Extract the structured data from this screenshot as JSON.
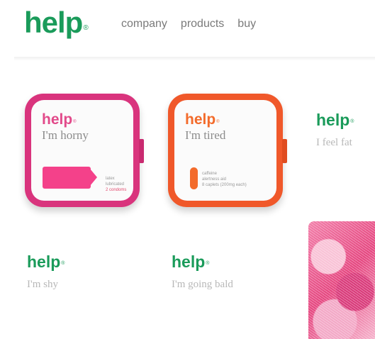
{
  "brand": {
    "logo": "help",
    "reg": "®"
  },
  "nav": [
    {
      "label": "company"
    },
    {
      "label": "products"
    },
    {
      "label": "buy"
    }
  ],
  "products": [
    {
      "brand": "help",
      "phrase": "I'm horny",
      "color": "#d9347d",
      "small_lines": [
        "latex",
        "lubricated",
        "2 condoms"
      ]
    },
    {
      "brand": "help",
      "phrase": "I'm tired",
      "color": "#f0582a",
      "small_lines": [
        "caffeine",
        "alertness aid",
        "8 caplets (200mg each)"
      ]
    }
  ],
  "tiles": [
    {
      "brand": "help",
      "phrase": "I feel fat"
    },
    {
      "brand": "help",
      "phrase": "I'm shy"
    },
    {
      "brand": "help",
      "phrase": "I'm going bald"
    }
  ],
  "colors": {
    "brand_green": "#1a9b5a",
    "nav_gray": "#7a7a7a",
    "phrase_gray": "#b8b8b8"
  }
}
